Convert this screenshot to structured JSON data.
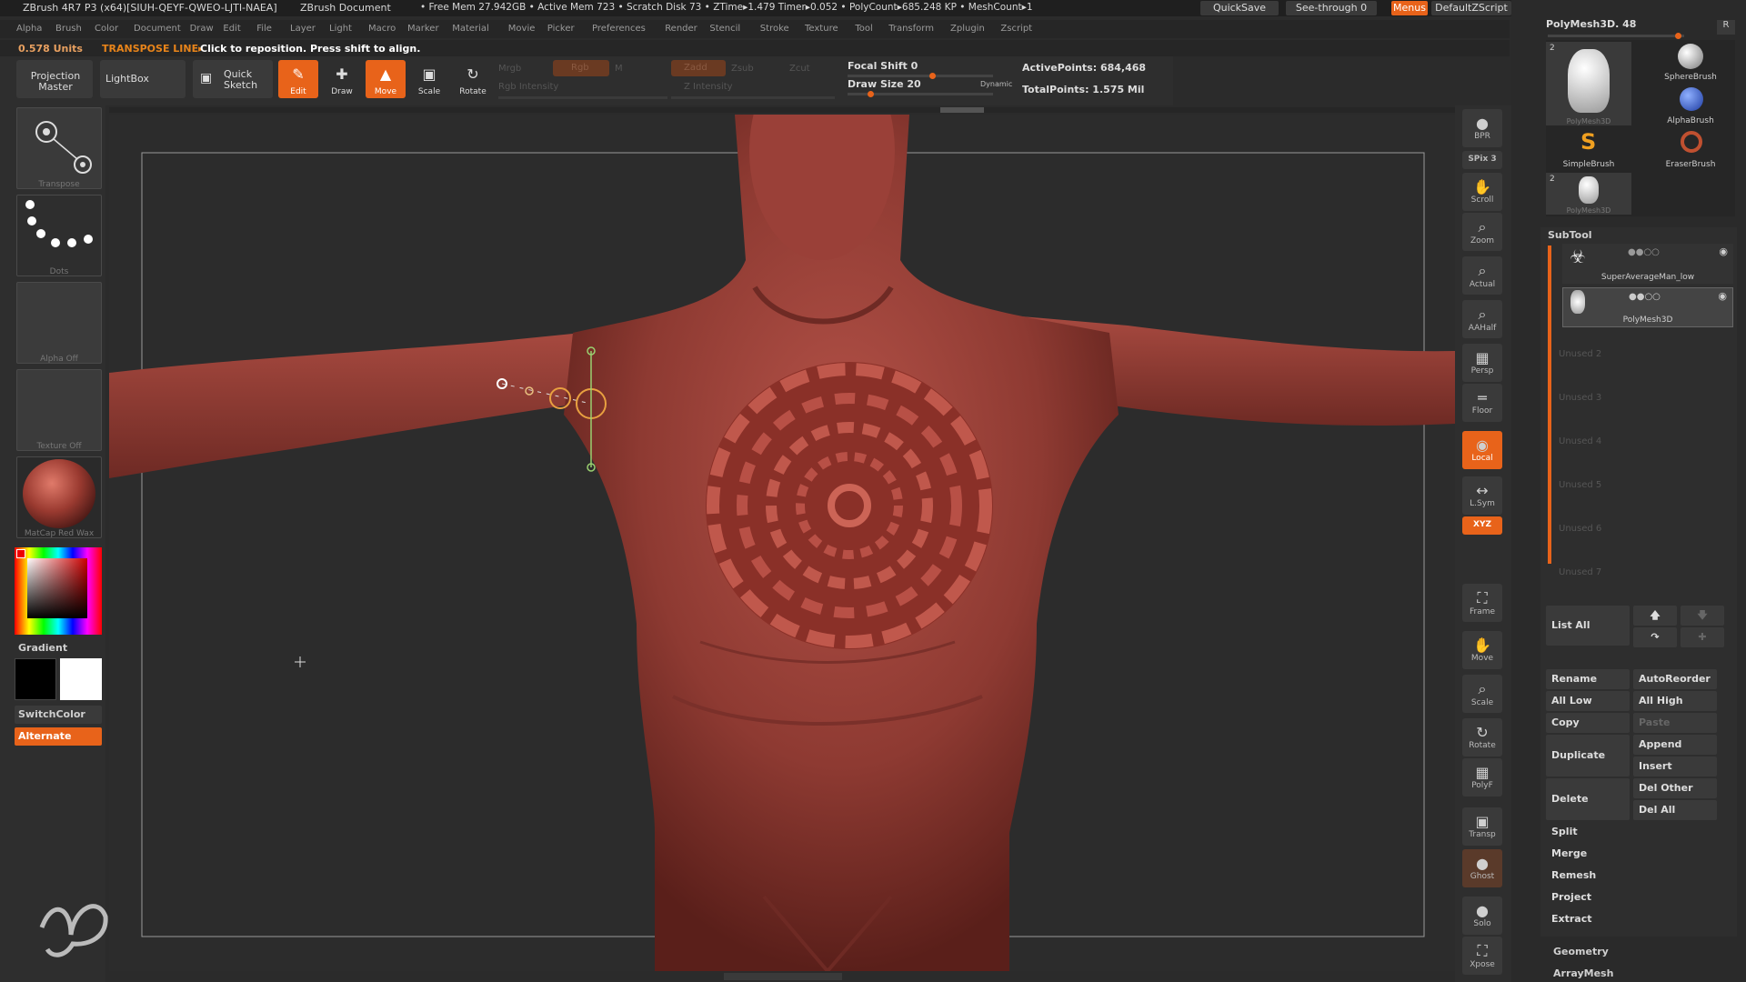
{
  "titlebar": {
    "app": "ZBrush 4R7 P3 (x64)[SIUH-QEYF-QWEO-LJTI-NAEA]",
    "doc": "ZBrush Document",
    "stats": "• Free Mem 27.942GB • Active Mem 723 • Scratch Disk 73 • ZTime▸1.479 Timer▸0.052 • PolyCount▸685.248 KP • MeshCount▸1",
    "quicksave": "QuickSave",
    "seethrough": "See-through  0",
    "menus": "Menus",
    "script": "DefaultZScript"
  },
  "menubar": [
    "Alpha",
    "Brush",
    "Color",
    "Document",
    "Draw",
    "Edit",
    "File",
    "Layer",
    "Light",
    "Macro",
    "Marker",
    "Material",
    "Movie",
    "Picker",
    "Preferences",
    "Render",
    "Stencil",
    "Stroke",
    "Texture",
    "Tool",
    "Transform",
    "Zplugin",
    "Zscript"
  ],
  "notebar": {
    "units": "0.578 Units",
    "mode": "TRANSPOSE LINE▸",
    "hint": "Click to reposition. Press shift to align."
  },
  "toolbar": {
    "projection_master": "Projection Master",
    "lightbox": "LightBox",
    "quick_sketch": "Quick Sketch",
    "edit": "Edit",
    "draw": "Draw",
    "move": "Move",
    "scale": "Scale",
    "rotate": "Rotate",
    "mrgb": "Mrgb",
    "rgb": "Rgb",
    "m": "M",
    "rgb_intensity": "Rgb Intensity",
    "zadd": "Zadd",
    "zsub": "Zsub",
    "zcut": "Zcut",
    "z_intensity": "Z Intensity",
    "focal_shift": "Focal Shift 0",
    "draw_size": "Draw Size 20",
    "dynamic": "Dynamic",
    "active_points": "ActivePoints: 684,468",
    "total_points": "TotalPoints: 1.575 Mil"
  },
  "leftshelf": {
    "transpose": "Transpose",
    "dots": "Dots",
    "alpha": "Alpha  Off",
    "texture": "Texture  Off",
    "material": "MatCap Red Wax",
    "gradient": "Gradient",
    "switchcolor": "SwitchColor",
    "alternate": "Alternate"
  },
  "rightshelf": [
    {
      "name": "bpr",
      "label": "BPR",
      "icon": "●"
    },
    {
      "name": "spix",
      "label": "SPix 3",
      "icon": ""
    },
    {
      "name": "scroll",
      "label": "Scroll",
      "icon": "✋"
    },
    {
      "name": "zoom",
      "label": "Zoom",
      "icon": "⌕"
    },
    {
      "name": "actual",
      "label": "Actual",
      "icon": "⌕"
    },
    {
      "name": "aahalf",
      "label": "AAHalf",
      "icon": "⌕"
    },
    {
      "name": "persp",
      "label": "Persp",
      "icon": "▦"
    },
    {
      "name": "floor",
      "label": "Floor",
      "icon": "═"
    },
    {
      "name": "local",
      "label": "Local",
      "icon": "◉"
    },
    {
      "name": "lsym",
      "label": "L.Sym",
      "icon": "↔"
    },
    {
      "name": "xyz",
      "label": "XYZ",
      "icon": ""
    },
    {
      "name": "frame",
      "label": "Frame",
      "icon": "⛶"
    },
    {
      "name": "move",
      "label": "Move",
      "icon": "✋"
    },
    {
      "name": "scale",
      "label": "Scale",
      "icon": "⌕"
    },
    {
      "name": "rotate",
      "label": "Rotate",
      "icon": "↻"
    },
    {
      "name": "polyf",
      "label": "PolyF",
      "icon": "▦"
    },
    {
      "name": "transp",
      "label": "Transp",
      "icon": "▣"
    },
    {
      "name": "ghost",
      "label": "Ghost",
      "icon": "●"
    },
    {
      "name": "solo",
      "label": "Solo",
      "icon": "●"
    },
    {
      "name": "xpose",
      "label": "Xpose",
      "icon": "⛶"
    }
  ],
  "tool": {
    "title": "PolyMesh3D. 48",
    "r": "R",
    "items": [
      {
        "label": "PolyMesh3D",
        "count": "2"
      },
      {
        "label": "SphereBrush"
      },
      {
        "label": "AlphaBrush"
      },
      {
        "label": "SimpleBrush"
      },
      {
        "label": "EraserBrush"
      },
      {
        "label": "PolyMesh3D",
        "count": "2"
      }
    ]
  },
  "subtool": {
    "title": "SubTool",
    "items": [
      "SuperAverageMan_low",
      "PolyMesh3D"
    ],
    "unused": [
      "Unused 2",
      "Unused 3",
      "Unused 4",
      "Unused 5",
      "Unused 6",
      "Unused 7"
    ],
    "list_all": "List  All",
    "buttons": {
      "rename": "Rename",
      "autoreorder": "AutoReorder",
      "all_low": "All Low",
      "all_high": "All High",
      "copy": "Copy",
      "paste": "Paste",
      "duplicate": "Duplicate",
      "append": "Append",
      "insert": "Insert",
      "delete": "Delete",
      "del_other": "Del Other",
      "del_all": "Del All",
      "split": "Split",
      "merge": "Merge",
      "remesh": "Remesh",
      "project": "Project",
      "extract": "Extract"
    }
  },
  "sections": {
    "geometry": "Geometry",
    "arraymesh": "ArrayMesh"
  },
  "colors": {
    "accent": "#e8631a",
    "skin": "#a8473f"
  }
}
